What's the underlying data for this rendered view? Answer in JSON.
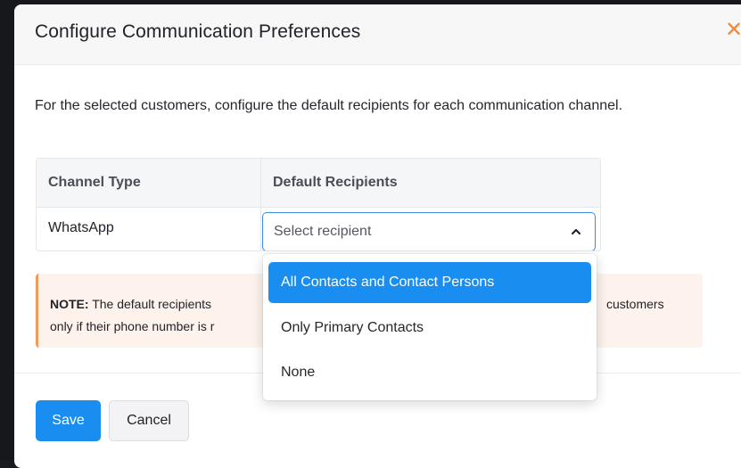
{
  "modal": {
    "title": "Configure Communication Preferences",
    "close_icon": "close-icon",
    "description": "For the selected customers, configure the default recipients for each communication channel."
  },
  "table": {
    "headers": [
      "Channel Type",
      "Default Recipients"
    ],
    "rows": [
      {
        "channel": "WhatsApp",
        "recipient_placeholder": "Select recipient"
      }
    ]
  },
  "note": {
    "label": "NOTE:",
    "text_visible": " The default recipients",
    "text_line2": "only if their phone number is r",
    "text_tail": "customers"
  },
  "dropdown": {
    "chevron_icon": "chevron-up-icon",
    "options": [
      "All Contacts and Contact Persons",
      "Only Primary Contacts",
      "None"
    ],
    "highlighted_index": 0
  },
  "footer": {
    "save_label": "Save",
    "cancel_label": "Cancel"
  },
  "colors": {
    "primary": "#1a8ef0",
    "accent_close": "#f08a3c",
    "note_bg": "#fdf3ec",
    "note_border": "#f29a5a"
  }
}
